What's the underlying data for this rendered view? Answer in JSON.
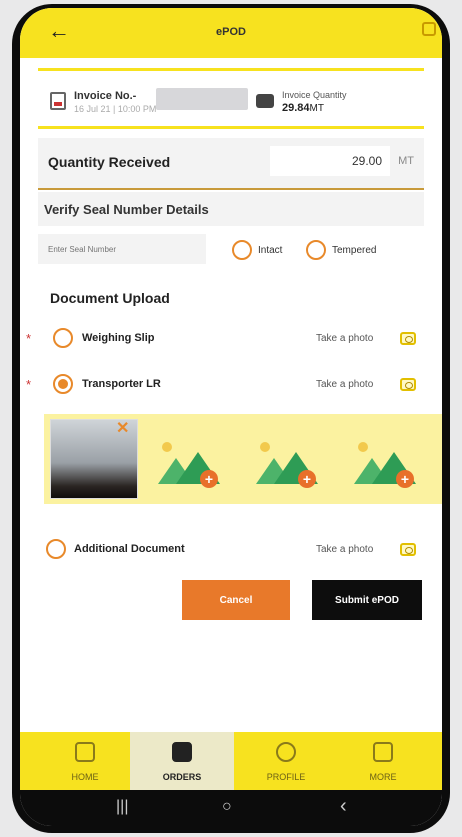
{
  "header": {
    "back_icon": "back-arrow-icon",
    "title": "ePOD"
  },
  "invoice": {
    "number_label": "Invoice No.-",
    "date": "16 Jul 21 | 10:00 PM",
    "quantity_label": "Invoice Quantity",
    "quantity_value": "29.84",
    "quantity_unit": "MT"
  },
  "quantity_received": {
    "label": "Quantity Received",
    "value": "29.00",
    "unit": "MT"
  },
  "seal": {
    "title": "Verify Seal Number Details",
    "input_placeholder": "Enter Seal Number",
    "options": [
      "Intact",
      "Tempered"
    ]
  },
  "documents": {
    "title": "Document Upload",
    "take_photo_label": "Take a photo",
    "items": [
      {
        "label": "Weighing Slip",
        "required": true,
        "selected": false
      },
      {
        "label": "Transporter LR",
        "required": true,
        "selected": true
      },
      {
        "label": "Additional Document",
        "required": false,
        "selected": false
      }
    ]
  },
  "actions": {
    "cancel_label": "Cancel",
    "submit_label": "Submit ePOD"
  },
  "bottom_nav": [
    {
      "label": "HOME",
      "icon": "home-icon"
    },
    {
      "label": "ORDERS",
      "icon": "shopping-bag-icon",
      "active": true
    },
    {
      "label": "PROFILE",
      "icon": "person-icon"
    },
    {
      "label": "MORE",
      "icon": "grid-icon"
    }
  ],
  "system_nav": {
    "recent": "|||",
    "home": "○",
    "back": "‹"
  },
  "colors": {
    "brand_yellow": "#f7e21f",
    "accent_orange": "#e8792a"
  }
}
